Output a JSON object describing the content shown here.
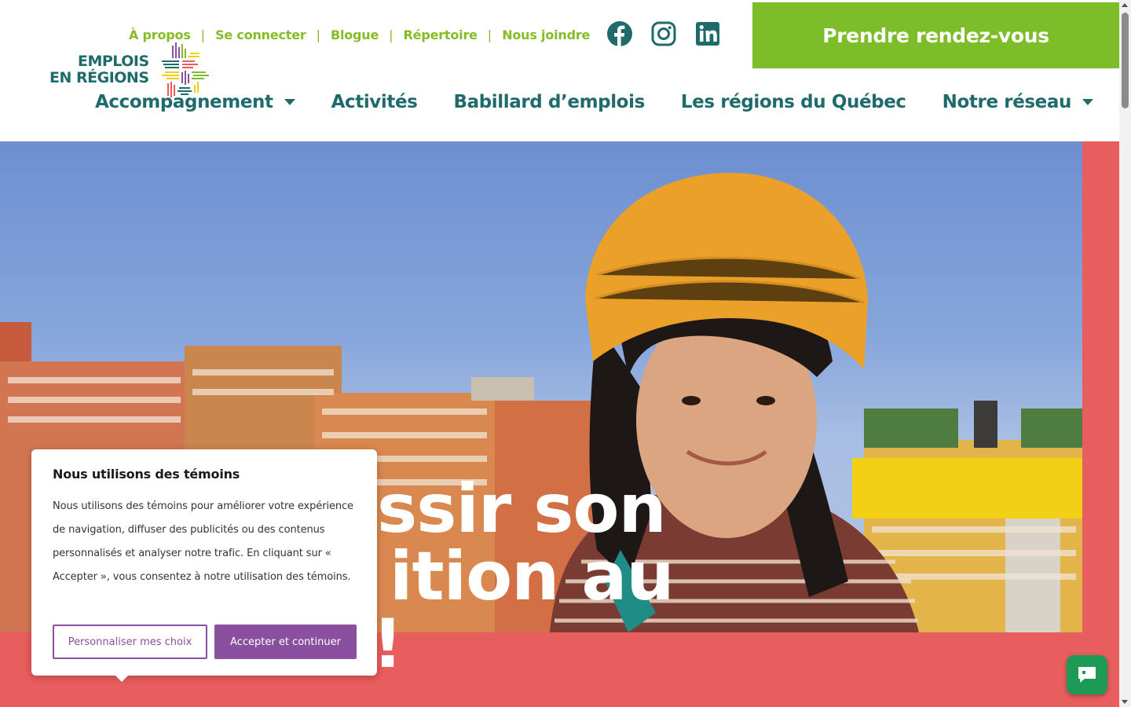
{
  "topnav": {
    "links": [
      "À propos",
      "Se connecter",
      "Blogue",
      "Répertoire",
      "Nous joindre"
    ]
  },
  "socials": [
    "facebook-icon",
    "instagram-icon",
    "linkedin-icon"
  ],
  "cta": {
    "label": "Prendre rendez-vous"
  },
  "logo": {
    "line1": "EMPLOIS",
    "line2": "EN RÉGIONS"
  },
  "mainnav": {
    "items": [
      {
        "label": "Accompagnement",
        "dropdown": true
      },
      {
        "label": "Activités",
        "dropdown": false
      },
      {
        "label": "Babillard d’emplois",
        "dropdown": false
      },
      {
        "label": "Les régions du Québec",
        "dropdown": false
      },
      {
        "label": "Notre réseau",
        "dropdown": true
      }
    ]
  },
  "hero": {
    "title_line1": "ssir son",
    "title_line2": "ition au",
    "title_line3": "!"
  },
  "cookie": {
    "title": "Nous utilisons des témoins ",
    "body": "Nous utilisons des témoins pour améliorer votre expérience de navigation, diffuser des publicités ou des contenus personnalisés et analyser notre trafic. En cliquant sur « Accepter », vous consentez à notre utilisation des témoins.",
    "customize_label": "Personnaliser mes choix",
    "accept_label": "Accepter et continuer"
  },
  "colors": {
    "accent_green": "#7cbd29",
    "nav_teal": "#1f6b6b",
    "hero_red": "#e85d5d",
    "hero_yellow": "#f2d015",
    "cookie_purple": "#8a4f9e",
    "chat_green": "#1e9a57"
  }
}
